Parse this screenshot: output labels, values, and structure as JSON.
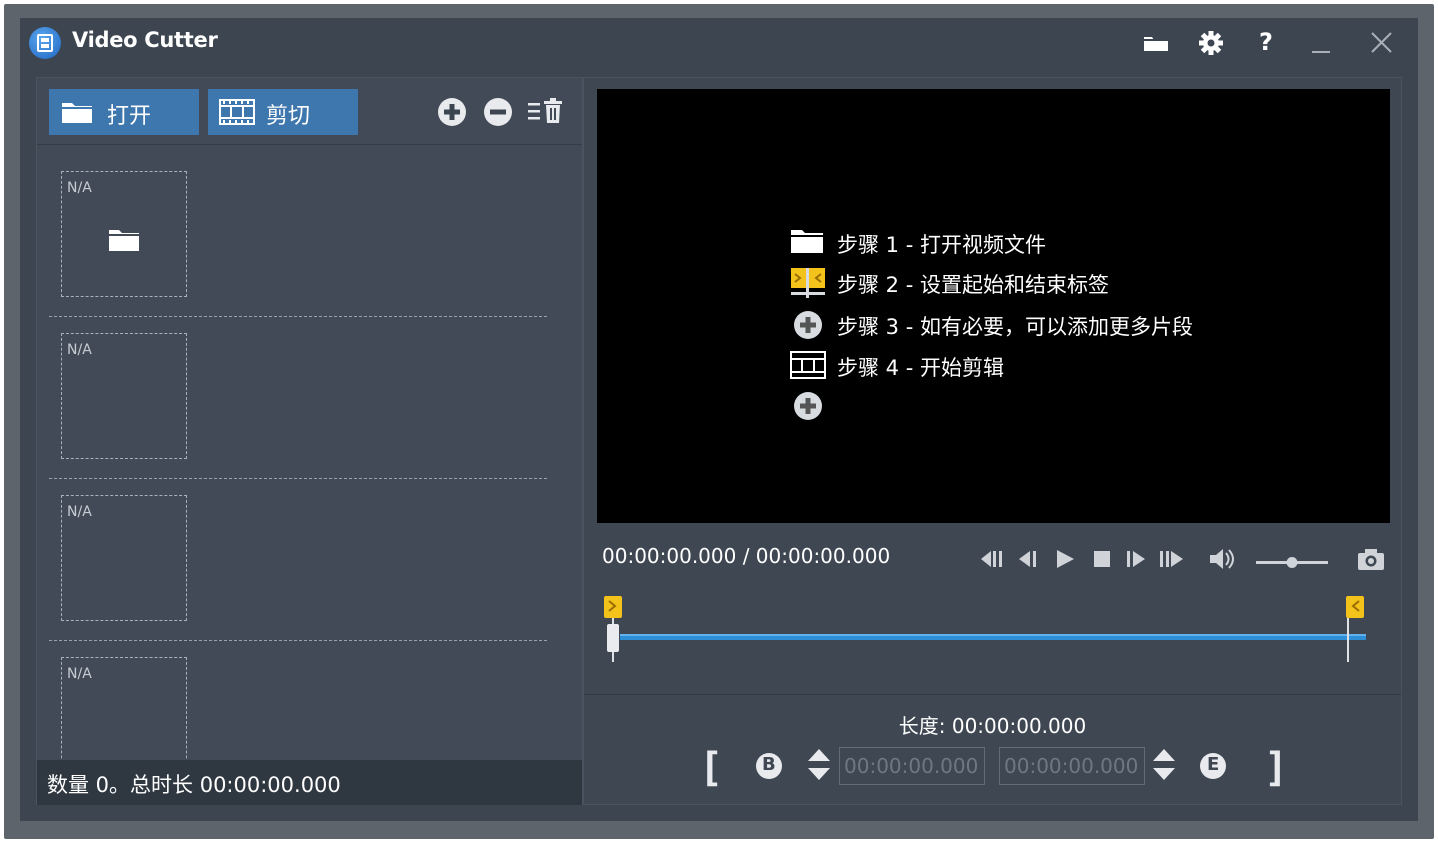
{
  "window": {
    "title": "Video Cutter"
  },
  "title_bar": {
    "buttons": [
      "folder-icon",
      "gear-icon",
      "help-icon",
      "minimize-icon",
      "close-icon"
    ],
    "help_label": "?"
  },
  "toolbar": {
    "open_label": "打开",
    "cut_label": "剪切"
  },
  "file_list": {
    "items": [
      {
        "label": "N/A"
      },
      {
        "label": "N/A"
      },
      {
        "label": "N/A"
      },
      {
        "label": "N/A"
      }
    ]
  },
  "status": {
    "text": "数量 0。总时长 00:00:00.000"
  },
  "player": {
    "steps": [
      {
        "icon": "folder-icon",
        "text": "步骤 1 - 打开视频文件"
      },
      {
        "icon": "flags-icon",
        "text": "步骤 2 - 设置起始和结束标签"
      },
      {
        "icon": "plus-circle-icon",
        "text": "步骤 3 - 如有必要，可以添加更多片段"
      },
      {
        "icon": "film-icon",
        "text": "步骤 4 - 开始剪辑"
      }
    ],
    "time": "00:00:00.000 / 00:00:00.000",
    "volume": 0.5
  },
  "range": {
    "length_label": "长度: 00:00:00.000",
    "start_value": "00:00:00.000",
    "end_value": "00:00:00.000",
    "begin_badge": "B",
    "end_badge": "E",
    "open_bracket": "[",
    "close_bracket": "]"
  },
  "colors": {
    "window_bg": "#3c4550",
    "accent_button": "#3e76ae",
    "timeline_blue": "#2f8fd6",
    "flag_yellow": "#f3c31c",
    "status_bg": "#2f3741"
  }
}
